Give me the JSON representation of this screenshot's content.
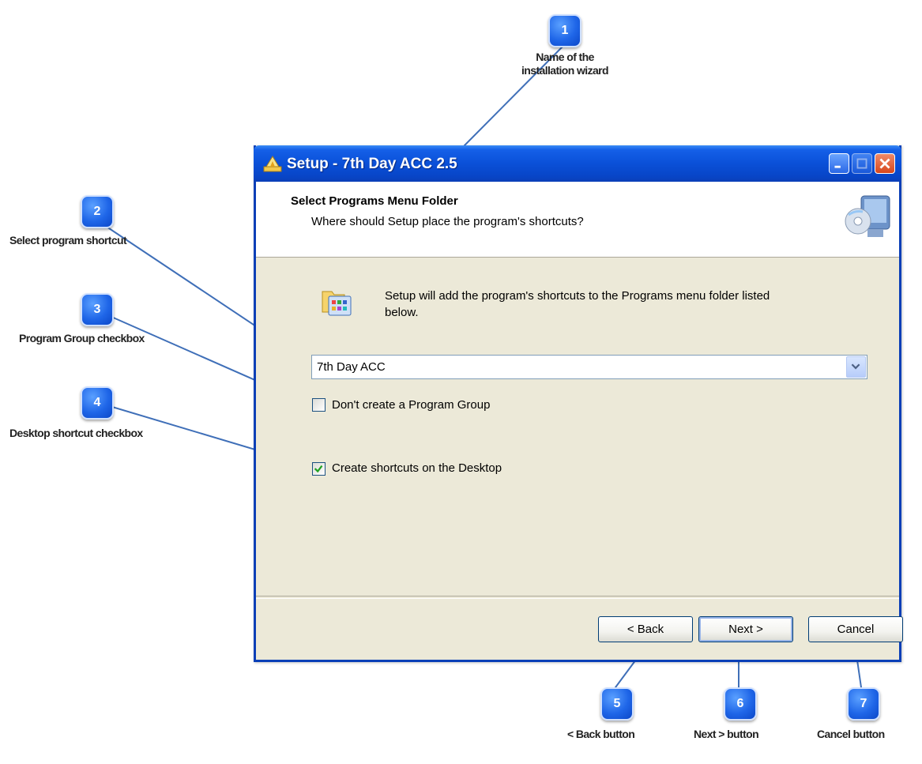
{
  "window": {
    "title": "Setup - 7th Day ACC 2.5"
  },
  "header": {
    "title": "Select Programs Menu Folder",
    "subtitle": "Where should Setup place the program's shortcuts?"
  },
  "content": {
    "info_line1": "Setup will add the program's shortcuts to the Programs menu folder listed",
    "info_line2": "below.",
    "folder_select": {
      "value": "7th Day ACC"
    },
    "checkbox_program_group": {
      "label": "Don't create a Program Group",
      "checked": false
    },
    "checkbox_desktop": {
      "label": "Create shortcuts on the Desktop",
      "checked": true
    }
  },
  "buttons": {
    "back": "< Back",
    "next": "Next >",
    "cancel": "Cancel"
  },
  "annotations": [
    {
      "number": "1",
      "label_line1": "Name of the",
      "label_line2": "installation wizard"
    },
    {
      "number": "2",
      "label": "Select program shortcut"
    },
    {
      "number": "3",
      "label": "Program Group checkbox"
    },
    {
      "number": "4",
      "label": "Desktop shortcut checkbox"
    },
    {
      "number": "5",
      "label": "< Back button"
    },
    {
      "number": "6",
      "label": "Next > button"
    },
    {
      "number": "7",
      "label": "Cancel button"
    }
  ],
  "colors": {
    "title_bar": "#0a50d8",
    "window_face": "#ece9d8",
    "callout_badge": "#1f66e8"
  }
}
